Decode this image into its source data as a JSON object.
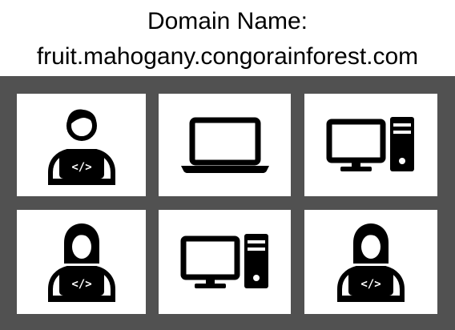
{
  "header": {
    "line1": "Domain Name:",
    "line2": "fruit.mahogany.congorainforest.com"
  },
  "tiles": [
    {
      "icon": "male-developer-icon"
    },
    {
      "icon": "laptop-icon"
    },
    {
      "icon": "desktop-computer-icon"
    },
    {
      "icon": "female-developer-icon"
    },
    {
      "icon": "desktop-computer-icon"
    },
    {
      "icon": "female-developer-icon"
    }
  ],
  "code_symbol": "</>",
  "colors": {
    "background": "#ffffff",
    "panel": "#515151",
    "tile": "#ffffff",
    "icon": "#000000"
  }
}
